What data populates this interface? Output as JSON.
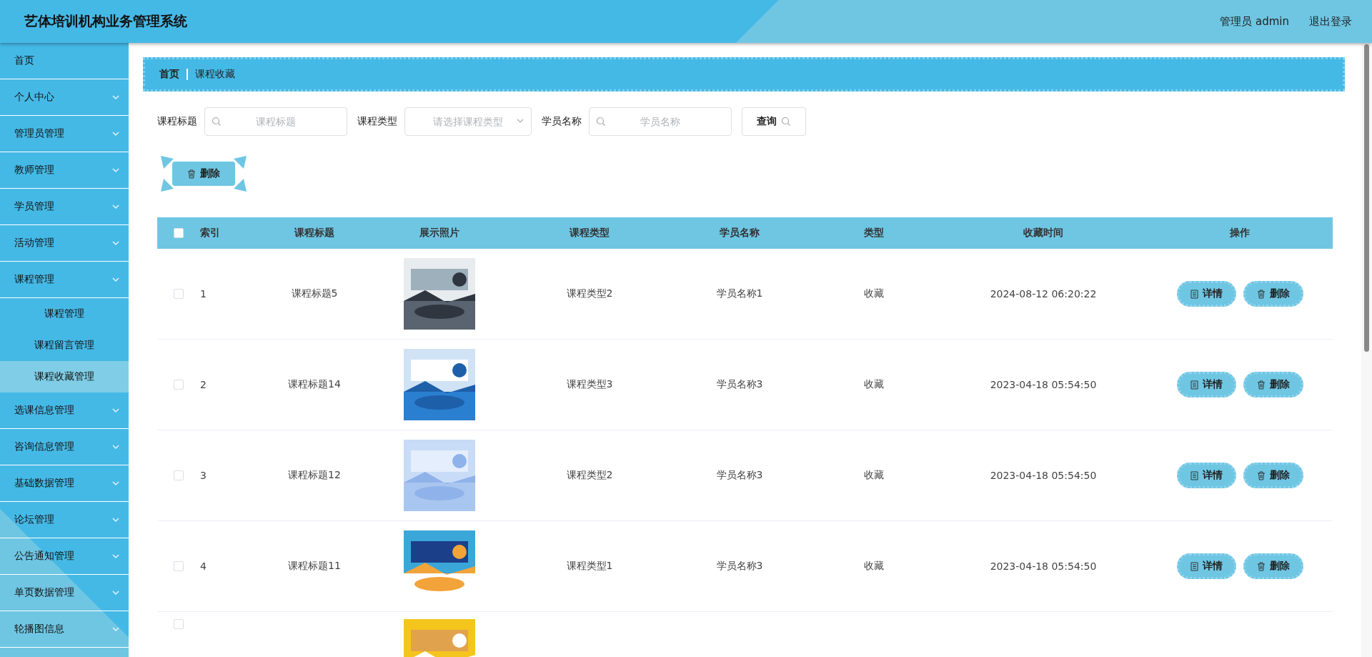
{
  "header": {
    "title": "艺体培训机构业务管理系统",
    "user": "管理员 admin",
    "logout": "退出登录"
  },
  "sidebar": {
    "items": [
      {
        "kind": "link",
        "label": "首页",
        "selected": false
      },
      {
        "kind": "group",
        "label": "个人中心",
        "selected": false
      },
      {
        "kind": "group",
        "label": "管理员管理",
        "selected": false
      },
      {
        "kind": "group",
        "label": "教师管理",
        "selected": false
      },
      {
        "kind": "group",
        "label": "学员管理",
        "selected": false
      },
      {
        "kind": "group",
        "label": "活动管理",
        "selected": false
      },
      {
        "kind": "group",
        "label": "课程管理",
        "selected": false,
        "children": [
          {
            "label": "课程管理",
            "selected": false
          },
          {
            "label": "课程留言管理",
            "selected": false
          },
          {
            "label": "课程收藏管理",
            "selected": true
          }
        ]
      },
      {
        "kind": "group",
        "label": "选课信息管理",
        "selected": false
      },
      {
        "kind": "group",
        "label": "咨询信息管理",
        "selected": false
      },
      {
        "kind": "group",
        "label": "基础数据管理",
        "selected": false
      },
      {
        "kind": "group",
        "label": "论坛管理",
        "selected": false
      },
      {
        "kind": "group",
        "label": "公告通知管理",
        "selected": false
      },
      {
        "kind": "group",
        "label": "单页数据管理",
        "selected": false
      },
      {
        "kind": "group",
        "label": "轮播图信息",
        "selected": false
      }
    ]
  },
  "breadcrumb": [
    "首页",
    "课程收藏"
  ],
  "search": {
    "fields": [
      {
        "kind": "text",
        "label": "课程标题",
        "placeholder": "课程标题"
      },
      {
        "kind": "select",
        "label": "课程类型",
        "placeholder": "请选择课程类型"
      },
      {
        "kind": "text",
        "label": "学员名称",
        "placeholder": "学员名称"
      }
    ],
    "button": "查询"
  },
  "toolbar": {
    "delete_button": "删除"
  },
  "table": {
    "all_checked": false,
    "columns": [
      "索引",
      "课程标题",
      "展示照片",
      "课程类型",
      "学员名称",
      "类型",
      "收藏时间",
      "操作"
    ],
    "rows": [
      {
        "kind": "full",
        "checked": false,
        "index": "1",
        "title": "课程标题5",
        "photo": {
          "kind": "picture"
        },
        "course_type": "课程类型2",
        "student": "学员名称1",
        "type": "收藏",
        "time": "2024-08-12 06:20:22",
        "actions": [
          "详情",
          "删除"
        ]
      },
      {
        "kind": "full",
        "checked": false,
        "index": "2",
        "title": "课程标题14",
        "photo": {
          "kind": "picture"
        },
        "course_type": "课程类型3",
        "student": "学员名称3",
        "type": "收藏",
        "time": "2023-04-18 05:54:50",
        "actions": [
          "详情",
          "删除"
        ]
      },
      {
        "kind": "full",
        "checked": false,
        "index": "3",
        "title": "课程标题12",
        "photo": {
          "kind": "picture"
        },
        "course_type": "课程类型2",
        "student": "学员名称3",
        "type": "收藏",
        "time": "2023-04-18 05:54:50",
        "actions": [
          "详情",
          "删除"
        ]
      },
      {
        "kind": "full",
        "checked": false,
        "index": "4",
        "title": "课程标题11",
        "photo": {
          "kind": "picture"
        },
        "course_type": "课程类型1",
        "student": "学员名称3",
        "type": "收藏",
        "time": "2023-04-18 05:54:50",
        "actions": [
          "详情",
          "删除"
        ]
      },
      {
        "kind": "partial",
        "checked": false,
        "photo": {
          "kind": "picture"
        }
      }
    ]
  }
}
